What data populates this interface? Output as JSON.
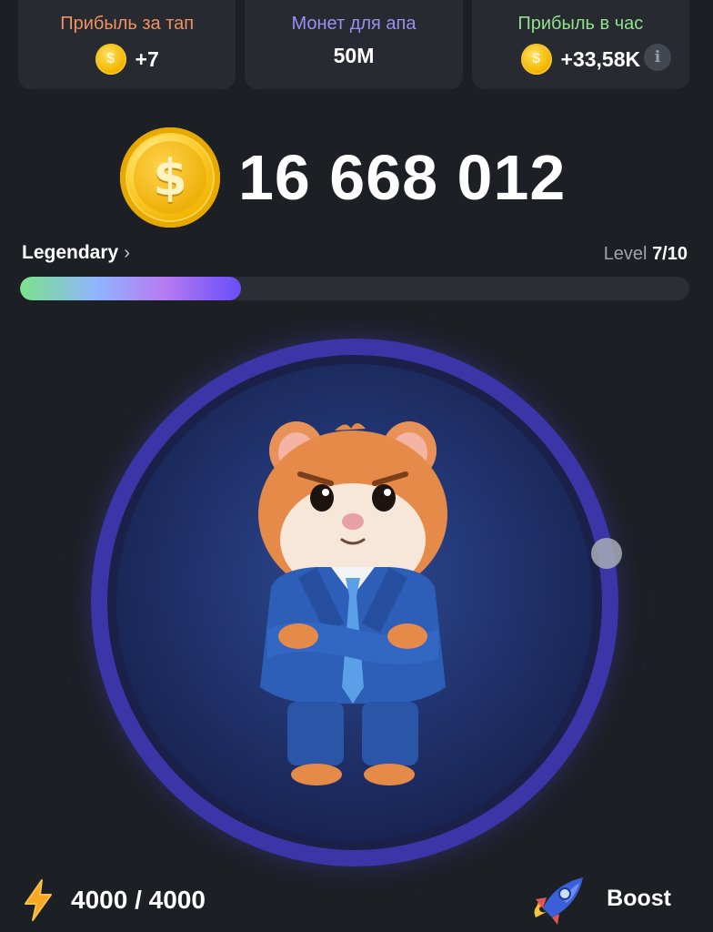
{
  "stats": {
    "per_tap": {
      "label": "Прибыль за тап",
      "value": "+7",
      "label_color": "#f0915f",
      "icon": "coin-icon"
    },
    "coins_to_level_up": {
      "label": "Монет для апа",
      "value": "50M",
      "label_color": "#9a8ff0"
    },
    "per_hour": {
      "label": "Прибыль в час",
      "value": "+33,58K",
      "label_color": "#8fe18a",
      "icon": "coin-icon",
      "info_icon": "info-icon",
      "info_glyph": "i"
    }
  },
  "balance": {
    "value": "16 668 012",
    "icon": "coin-icon",
    "coin_glyph": "$"
  },
  "level": {
    "league": "Legendary",
    "chevron": "›",
    "level_prefix": "Level",
    "level_value": "7/10",
    "progress_fraction": 0.33
  },
  "tap_area": {
    "image": "hamster-ceo"
  },
  "energy": {
    "value": "4000 / 4000",
    "icon": "lightning-icon"
  },
  "boost": {
    "label": "Boost",
    "icon": "rocket-icon"
  },
  "colors": {
    "background": "#1c1f24",
    "card": "#272a30",
    "coin": "#f5b800",
    "ring": "#3b35a8",
    "progress_start": "#7ce28c",
    "progress_end": "#6a4dfa"
  }
}
